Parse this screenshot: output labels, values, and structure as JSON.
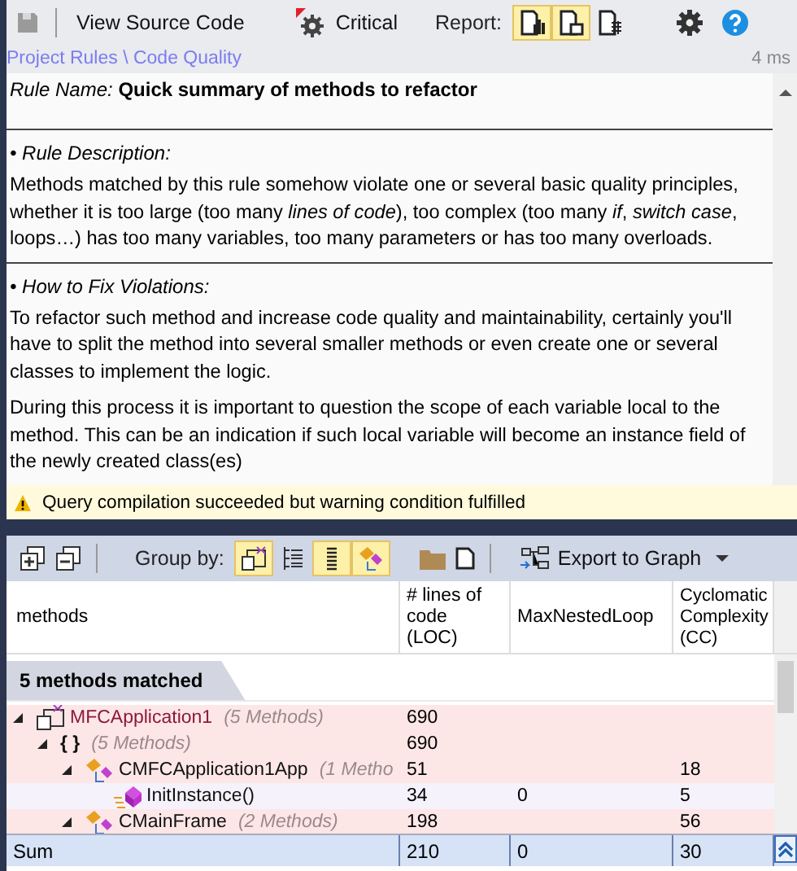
{
  "toolbar": {
    "view_source": "View Source Code",
    "severity": "Critical",
    "report_label": "Report:",
    "report_buttons": [
      {
        "selected": true
      },
      {
        "selected": true
      },
      {
        "selected": false
      }
    ]
  },
  "breadcrumb": "Project Rules \\ Code Quality",
  "duration": "4 ms",
  "rule": {
    "name_label": "Rule Name:",
    "name": "Quick summary of methods to refactor",
    "sections": [
      {
        "heading": "• Rule Description:",
        "paragraphs": [
          "Methods matched by this rule somehow violate one or several basic quality principles, whether it is too large (too many *lines of code*), too complex (too many *if*, *switch case*, loops…) has too many variables, too many parameters or has too many overloads."
        ]
      },
      {
        "heading": "• How to Fix Violations:",
        "paragraphs": [
          "To refactor such method and increase code quality and maintainability, certainly you'll have to split the method into several smaller methods or even create one or several classes to implement the logic.",
          "During this process it is important to question the scope of each variable local to the method. This can be an indication if such local variable will become an instance field of the newly created class(es)"
        ]
      }
    ]
  },
  "status_message": "Query compilation succeeded but warning condition fulfilled",
  "results_toolbar": {
    "group_by_label": "Group by:",
    "group_buttons": [
      {
        "selected": true
      },
      {
        "selected": false
      },
      {
        "selected": true
      },
      {
        "selected": true
      }
    ],
    "export": "Export to Graph"
  },
  "table": {
    "columns": [
      "methods",
      "# lines of code (LOC)",
      "MaxNestedLoop",
      "Cyclomatic Complexity (CC)"
    ],
    "match_count": "5 methods matched",
    "rows": [
      {
        "kind": "project",
        "name": "MFCApplication1",
        "note": "(5 Methods)",
        "loc": "690",
        "expanded": true,
        "children": [
          {
            "kind": "namespace",
            "name": "{ }",
            "note": "(5 Methods)",
            "loc": "690",
            "expanded": true,
            "children": [
              {
                "kind": "class",
                "name": "CMFCApplication1App",
                "note": "(1 Metho",
                "loc": "51",
                "cc": "18",
                "expanded": true,
                "children": [
                  {
                    "kind": "method",
                    "name": "InitInstance()",
                    "loc": "34",
                    "max_nested_loop": "0",
                    "cc": "5"
                  }
                ]
              },
              {
                "kind": "class",
                "name": "CMainFrame",
                "note": "(2 Methods)",
                "loc": "198",
                "cc": "56",
                "expanded": true
              }
            ]
          }
        ]
      }
    ],
    "sum": {
      "label": "Sum",
      "loc": "210",
      "max_nested_loop": "0",
      "cc": "30"
    }
  }
}
